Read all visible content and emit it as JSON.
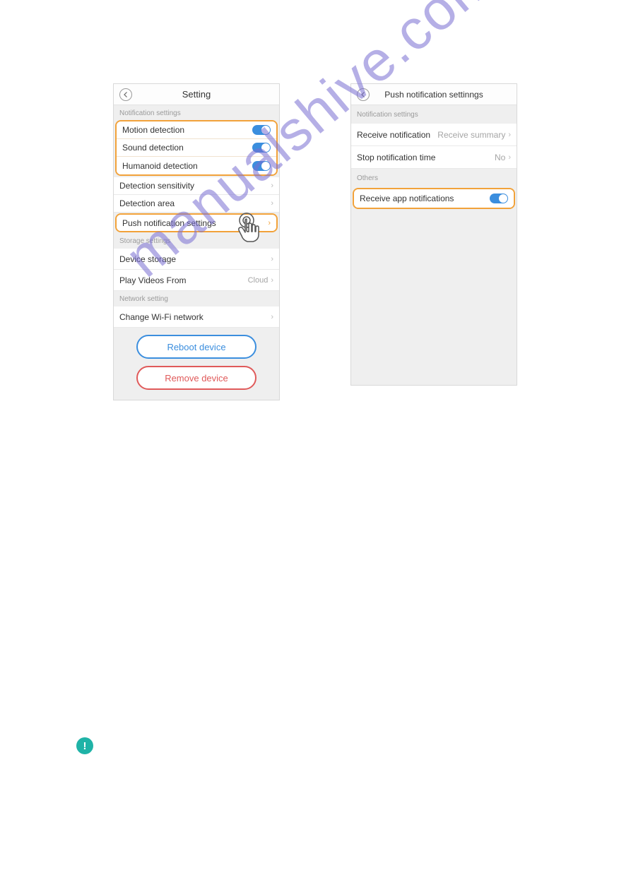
{
  "watermark": "manualshive.com",
  "note_icon": "!",
  "left_panel": {
    "title": "Setting",
    "sections": {
      "notif": "Notification settings",
      "storage": "Storage settings",
      "network": "Network setting"
    },
    "rows": {
      "motion": "Motion detection",
      "sound": "Sound detection",
      "humanoid": "Humanoid detection",
      "sensitivity": "Detection sensitivity",
      "area": "Detection area",
      "push": "Push notification settings",
      "device_storage": "Device storage",
      "play_from": "Play Videos From",
      "play_from_val": "Cloud",
      "wifi": "Change Wi-Fi network"
    },
    "buttons": {
      "reboot": "Reboot device",
      "remove": "Remove device"
    }
  },
  "right_panel": {
    "title": "Push notification settinngs",
    "sections": {
      "notif": "Notification settings",
      "others": "Others"
    },
    "rows": {
      "receive": "Receive notification",
      "receive_val": "Receive summary",
      "stop_time": "Stop notification time",
      "stop_time_val": "No",
      "app_notif": "Receive app notifications"
    }
  }
}
